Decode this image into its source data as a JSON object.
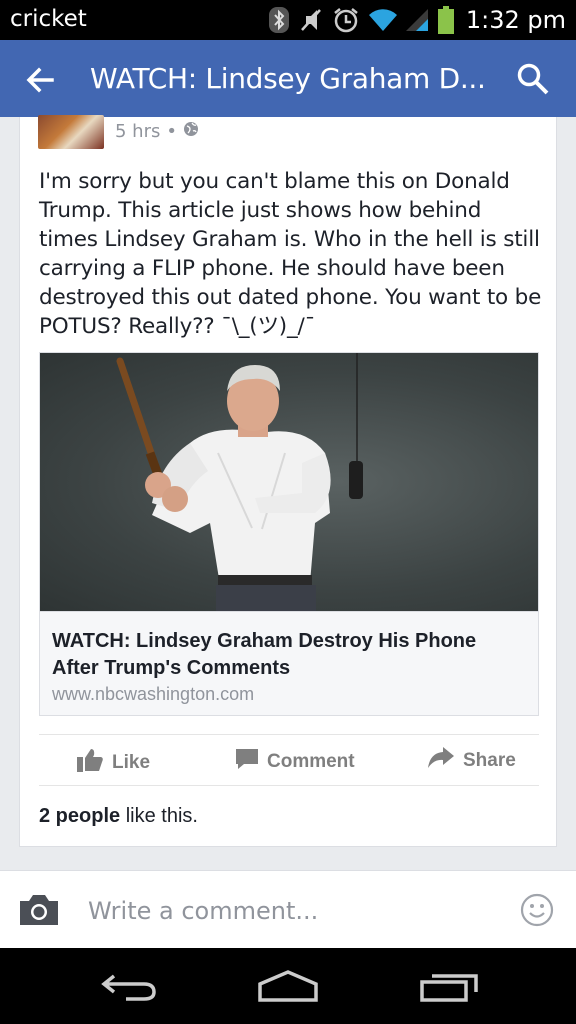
{
  "status_bar": {
    "carrier": "cricket",
    "time": "1:32 pm",
    "icons": [
      "bluetooth-icon",
      "mute-icon",
      "alarm-icon",
      "wifi-icon",
      "signal-icon",
      "battery-icon"
    ]
  },
  "app_bar": {
    "title": "WATCH: Lindsey Graham D...",
    "back_icon": "back-arrow-icon",
    "search_icon": "search-icon",
    "background": "#4267b2"
  },
  "post": {
    "time": "5 hrs",
    "separator": "•",
    "privacy_icon": "globe-icon",
    "text": "I'm sorry but you can't blame this on Donald Trump. This article just shows how behind times Lindsey Graham is. Who in the hell is still carrying a FLIP phone. He should have been destroyed this out dated phone. You want to be POTUS? Really?? ¯\\_(ツ)_/¯",
    "link": {
      "title": "WATCH: Lindsey Graham Destroy His Phone After Trump's Comments",
      "domain": "www.nbcwashington.com"
    },
    "actions": {
      "like": "Like",
      "comment": "Comment",
      "share": "Share"
    },
    "likes": {
      "count_text": "2 people",
      "suffix": " like this."
    }
  },
  "composer": {
    "placeholder": "Write a comment...",
    "camera_icon": "camera-icon",
    "emoji_icon": "smiley-icon"
  },
  "nav_bar": {
    "icons": [
      "back-nav-icon",
      "home-nav-icon",
      "recents-nav-icon"
    ]
  }
}
